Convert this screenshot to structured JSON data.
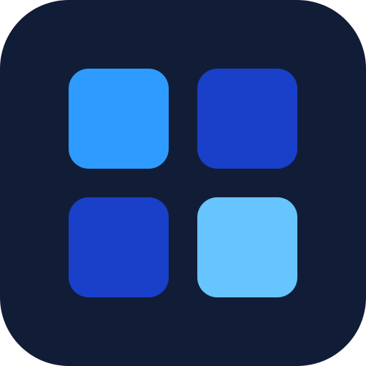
{
  "icon": {
    "semantic": "app-grid-icon",
    "background_color": "#111d36",
    "tiles": [
      {
        "name": "top-left-tile",
        "color": "#2d9bff"
      },
      {
        "name": "top-right-tile",
        "color": "#1a3fc8"
      },
      {
        "name": "bottom-left-tile",
        "color": "#1a3fc8"
      },
      {
        "name": "bottom-right-tile",
        "color": "#67c4ff"
      }
    ]
  }
}
